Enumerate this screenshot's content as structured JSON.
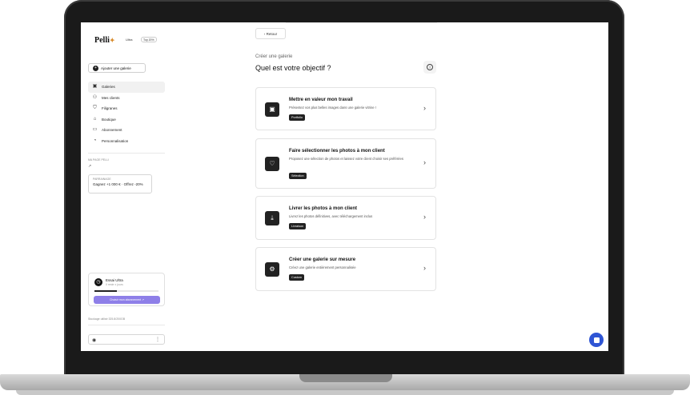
{
  "brand": {
    "name": "Pelli",
    "badge_ultra": "Ultra",
    "badge_top": "Top 20%"
  },
  "sidebar": {
    "add_gallery": "Ajouter une galerie",
    "items": [
      {
        "label": "Galeries",
        "icon": "image-icon"
      },
      {
        "label": "Mes clients",
        "icon": "users-icon"
      },
      {
        "label": "Filigranes",
        "icon": "shield-icon"
      },
      {
        "label": "Boutique",
        "icon": "bag-icon"
      },
      {
        "label": "Abonnement",
        "icon": "card-icon"
      },
      {
        "label": "Personnalisation",
        "icon": "palette-icon"
      }
    ],
    "my_page_label": "MA PAGE PELLI",
    "sponsor": {
      "title": "PARRAINAGE",
      "text": "Gagnez +1 000 € · Offrez -20%"
    },
    "trial": {
      "plan": "Essai Ultra",
      "remaining": "Il reste x jours",
      "progress": 0.35,
      "cta": "Choisir mon abonnement"
    },
    "storage": "Stockage utilisé 325.8/200GB"
  },
  "main": {
    "back_label": "Retour",
    "eyebrow": "Créer une galerie",
    "title": "Quel est votre objectif ?",
    "cards": [
      {
        "title": "Mettre en valeur mon travail",
        "desc": "Présentez vos plus belles images dans une galerie vitrine !",
        "tag": "Portfolio",
        "icon": "image-icon"
      },
      {
        "title": "Faire sélectionner les photos à mon client",
        "desc": "Proposez une sélection de photos et laissez votre client choisir ses préférées",
        "tag": "Sélection",
        "icon": "heart-icon"
      },
      {
        "title": "Livrer les photos à mon client",
        "desc": "Livrez les photos définitives, avec téléchargement inclus",
        "tag": "Livraison",
        "icon": "download-icon"
      },
      {
        "title": "Créer une galerie sur mesure",
        "desc": "Créez une galerie entièrement personnalisée",
        "tag": "Custom",
        "icon": "settings-icon"
      }
    ]
  },
  "colors": {
    "accent": "#8e7fe8",
    "chat": "#2f55d4",
    "dark": "#222222"
  }
}
